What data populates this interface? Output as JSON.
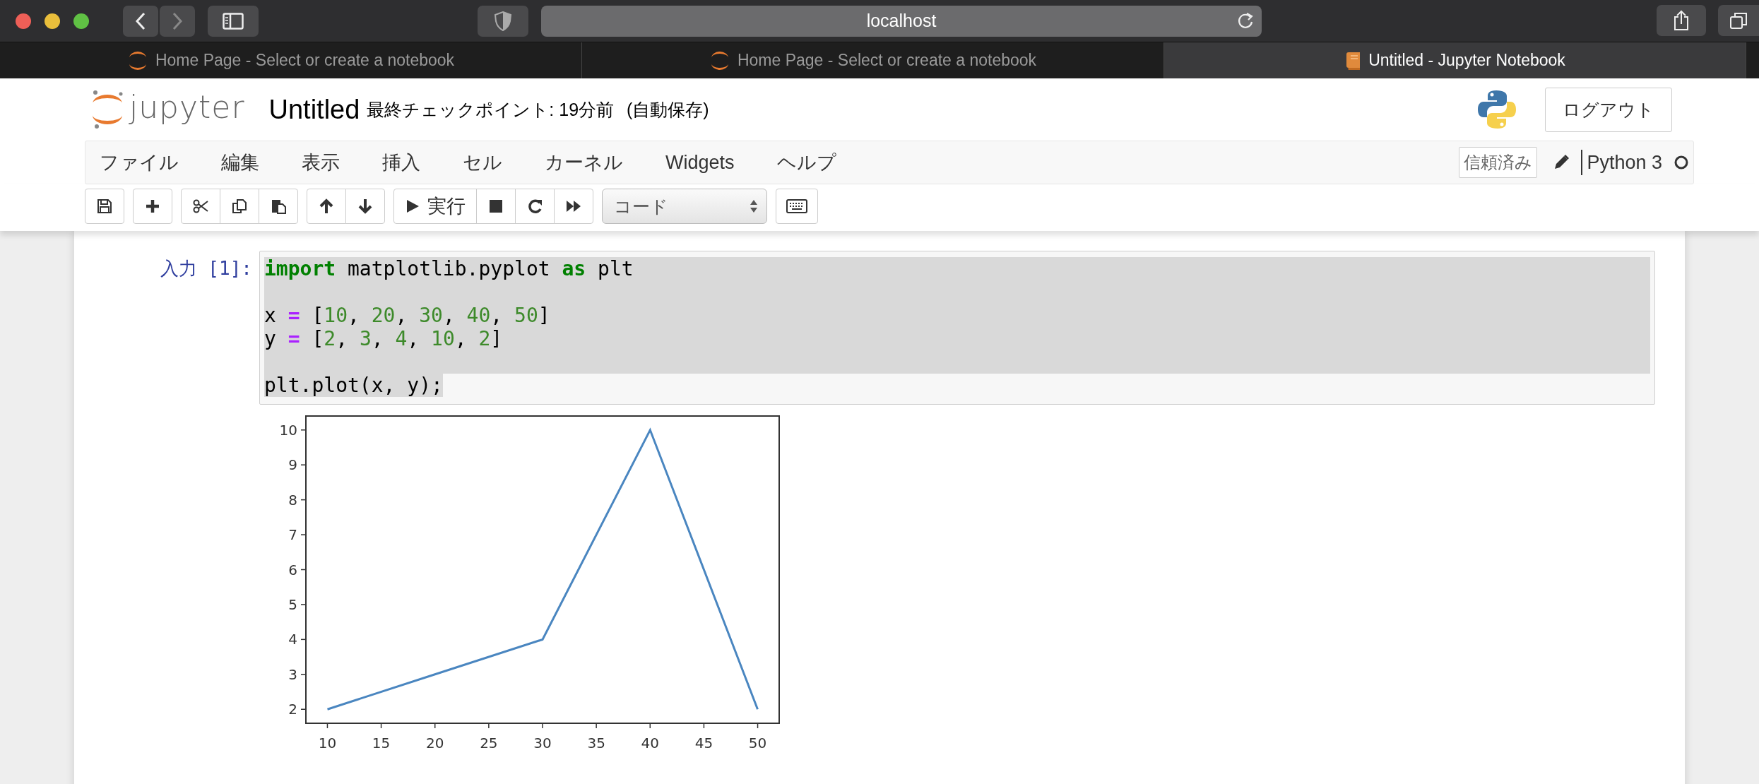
{
  "browser": {
    "url": "localhost",
    "tabs": [
      {
        "kind": "home",
        "title": "Home Page - Select or create a notebook",
        "selected": false
      },
      {
        "kind": "home",
        "title": "Home Page - Select or create a notebook",
        "selected": false
      },
      {
        "kind": "notebook",
        "title": "Untitled - Jupyter Notebook",
        "selected": true
      }
    ]
  },
  "header": {
    "logo_text": "jupyter",
    "notebook_name": "Untitled",
    "checkpoint": "最終チェックポイント: 19分前",
    "autosave": "(自動保存)",
    "logout": "ログアウト"
  },
  "menu": {
    "items": [
      "ファイル",
      "編集",
      "表示",
      "挿入",
      "セル",
      "カーネル",
      "Widgets",
      "ヘルプ"
    ],
    "trusted": "信頼済み",
    "kernel": "Python 3",
    "kernel_busy": false
  },
  "toolbar": {
    "run_label": "実行",
    "cell_type": "コード"
  },
  "cell": {
    "prompt": "入力 [1]:",
    "lines": [
      {
        "selected": true,
        "tokens": [
          {
            "kind": "keyword",
            "text": "import"
          },
          {
            "kind": "plain",
            "text": " matplotlib.pyplot "
          },
          {
            "kind": "keyword",
            "text": "as"
          },
          {
            "kind": "plain",
            "text": " plt"
          }
        ]
      },
      {
        "selected": true
      },
      {
        "selected": true,
        "tokens": [
          {
            "kind": "plain",
            "text": "x "
          },
          {
            "kind": "operator",
            "text": "="
          },
          {
            "kind": "plain",
            "text": " ["
          },
          {
            "kind": "number",
            "text": "10"
          },
          {
            "kind": "plain",
            "text": ", "
          },
          {
            "kind": "number",
            "text": "20"
          },
          {
            "kind": "plain",
            "text": ", "
          },
          {
            "kind": "number",
            "text": "30"
          },
          {
            "kind": "plain",
            "text": ", "
          },
          {
            "kind": "number",
            "text": "40"
          },
          {
            "kind": "plain",
            "text": ", "
          },
          {
            "kind": "number",
            "text": "50"
          },
          {
            "kind": "plain",
            "text": "]"
          }
        ]
      },
      {
        "selected": true,
        "tokens": [
          {
            "kind": "plain",
            "text": "y "
          },
          {
            "kind": "operator",
            "text": "="
          },
          {
            "kind": "plain",
            "text": " ["
          },
          {
            "kind": "number",
            "text": "2"
          },
          {
            "kind": "plain",
            "text": ", "
          },
          {
            "kind": "number",
            "text": "3"
          },
          {
            "kind": "plain",
            "text": ", "
          },
          {
            "kind": "number",
            "text": "4"
          },
          {
            "kind": "plain",
            "text": ", "
          },
          {
            "kind": "number",
            "text": "10"
          },
          {
            "kind": "plain",
            "text": ", "
          },
          {
            "kind": "number",
            "text": "2"
          },
          {
            "kind": "plain",
            "text": "]"
          }
        ]
      },
      {
        "selected": true
      },
      {
        "selected": true,
        "tokens": [
          {
            "kind": "plain",
            "text": "plt.plot(x, y);"
          }
        ]
      }
    ]
  },
  "output": {
    "chart_data": {
      "type": "line",
      "x": [
        10,
        20,
        30,
        40,
        50
      ],
      "series": [
        {
          "color": "#4a86c0",
          "values": [
            2,
            3,
            4,
            10,
            2
          ]
        }
      ],
      "xlim": [
        8,
        52
      ],
      "ylim": [
        1.6,
        10.4
      ],
      "xticks": [
        10,
        15,
        20,
        25,
        30,
        35,
        40,
        45,
        50
      ],
      "yticks": [
        2,
        3,
        4,
        5,
        6,
        7,
        8,
        9,
        10
      ]
    }
  }
}
